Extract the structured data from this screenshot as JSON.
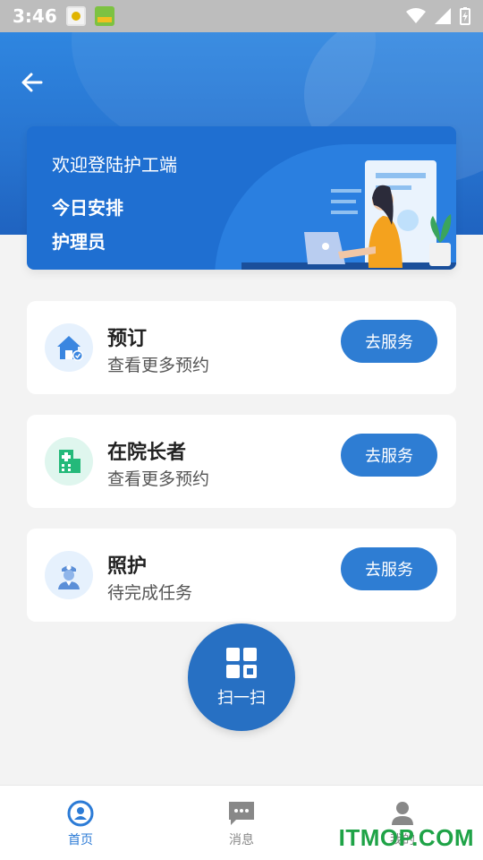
{
  "status_bar": {
    "time": "3:46"
  },
  "header": {
    "back_icon": "arrow-left-icon"
  },
  "banner": {
    "welcome": "欢迎登陆护工端",
    "line1": "今日安排",
    "line2": "护理员"
  },
  "cards": [
    {
      "title": "预订",
      "subtitle": "查看更多预约",
      "button": "去服务",
      "icon": "house-check-icon",
      "icon_bg": "#e6f1fd",
      "icon_color": "#3a86e0"
    },
    {
      "title": "在院长者",
      "subtitle": "查看更多预约",
      "button": "去服务",
      "icon": "hospital-icon",
      "icon_bg": "#dff6ee",
      "icon_color": "#24b97a"
    },
    {
      "title": "照护",
      "subtitle": "待完成任务",
      "button": "去服务",
      "icon": "nurse-icon",
      "icon_bg": "#e6f1fd",
      "icon_color": "#5b8fd8"
    }
  ],
  "scan": {
    "label": "扫一扫",
    "icon": "scan-grid-icon"
  },
  "tabs": [
    {
      "label": "首页",
      "icon": "home-user-icon",
      "active": true
    },
    {
      "label": "消息",
      "icon": "message-icon",
      "active": false
    },
    {
      "label": "我的",
      "icon": "person-icon",
      "active": false
    }
  ],
  "watermark": "ITMOP.COM",
  "colors": {
    "primary": "#2e7dd3",
    "header": "#2773cf",
    "active_tab": "#2c7bd6"
  }
}
